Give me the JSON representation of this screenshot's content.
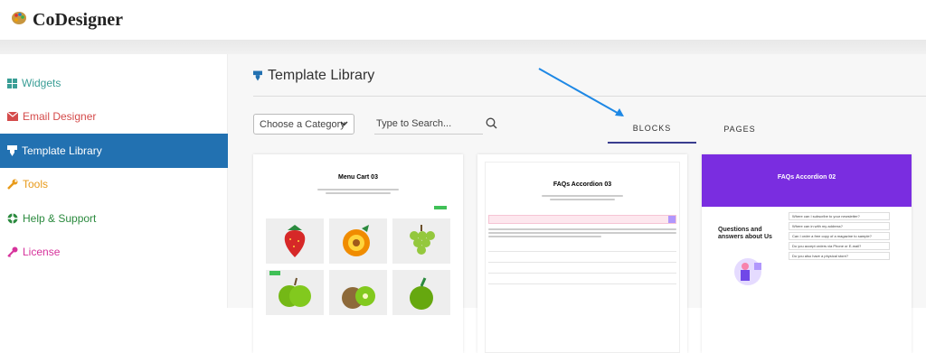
{
  "header": {
    "app_title": "CoDesigner",
    "logo_icon": "palette-icon"
  },
  "sidebar": {
    "items": [
      {
        "label": "Widgets",
        "icon": "grid-icon",
        "color": "#3a9e96"
      },
      {
        "label": "Email Designer",
        "icon": "envelope-icon",
        "color": "#d44b4b"
      },
      {
        "label": "Template Library",
        "icon": "template-icon",
        "color": "#ffffff",
        "active": true
      },
      {
        "label": "Tools",
        "icon": "wrench-icon",
        "color": "#e89a1a"
      },
      {
        "label": "Help & Support",
        "icon": "lifebuoy-icon",
        "color": "#2b8a3e"
      },
      {
        "label": "License",
        "icon": "key-icon",
        "color": "#d6339c"
      }
    ],
    "active_color": "#2271b1"
  },
  "main": {
    "title": "Template Library",
    "category_select": {
      "value": "Choose a Category"
    },
    "search": {
      "placeholder": "Type to Search..."
    },
    "tabs": [
      {
        "label": "BLOCKS",
        "active": true
      },
      {
        "label": "PAGES",
        "active": false
      }
    ],
    "cards": [
      {
        "heading": "Menu Cart 03"
      },
      {
        "heading": "FAQs Accordion 03"
      },
      {
        "heading": "FAQs Accordion 02",
        "faq_heading": "Questions and answers about Us",
        "questions": [
          "Where can I subscribe to your newsletter?",
          "Where can in with my address?",
          "Can I order a free copy of a magazine to sample?",
          "Do you accept orders via Phone or E-mail?",
          "Do you also have a physical store?"
        ]
      }
    ]
  }
}
